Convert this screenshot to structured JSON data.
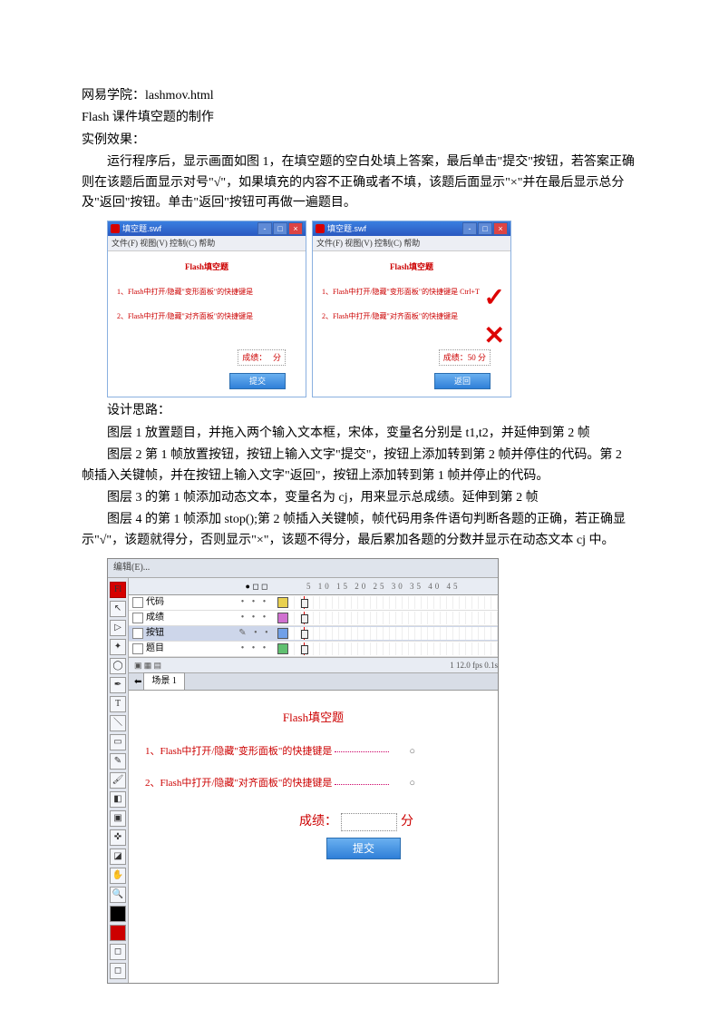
{
  "header": {
    "line1": "网易学院：lashmov.html",
    "line2": "Flash 课件填空题的制作",
    "line3": "实例效果："
  },
  "intro": "运行程序后，显示画面如图 1，在填空题的空白处填上答案，最后单击\"提交\"按钮，若答案正确则在该题后面显示对号\"√\"，如果填充的内容不正确或者不填，该题后面显示\"×\"并在最后显示总分及\"返回\"按钮。单击\"返回\"按钮可再做一遍题目。",
  "swf": {
    "winTitle": "填空题.swf",
    "menu": "文件(F) 视图(V) 控制(C) 帮助",
    "heading": "Flash填空题",
    "q1": "1、Flash中打开/隐藏\"变形面板\"的快捷键是",
    "q2": "2、Flash中打开/隐藏\"对齐面板\"的快捷键是",
    "q1r": "1、Flash中打开/隐藏\"变形面板\"的快捷键是  Ctrl+T",
    "q2r": "2、Flash中打开/隐藏\"对齐面板\"的快捷键是",
    "scoreLabel": "成绩：",
    "scoreUnit": "分",
    "scoreR": "成绩：50  分",
    "submit": "提交",
    "returnBtn": "返回"
  },
  "design": {
    "title": "设计思路：",
    "p1": "图层 1 放置题目，并拖入两个输入文本框，宋体，变量名分别是 t1,t2，并延伸到第 2 帧",
    "p2": "图层 2 第 1 帧放置按钮，按钮上输入文字\"提交\"，按钮上添加转到第 2 帧并停住的代码。第 2 帧插入关键帧，并在按钮上输入文字\"返回\"，按钮上添加转到第 1 帧并停止的代码。",
    "p3": "图层 3 的第 1 帧添加动态文本，变量名为 cj，用来显示总成绩。延伸到第 2 帧",
    "p4": "图层 4 的第 1 帧添加 stop();第 2 帧插入关键帧，帧代码用条件语句判断各题的正确，若正确显示\"√\"，该题就得分，否则显示\"×\"，该题不得分，最后累加各题的分数并显示在动态文本 cj 中。"
  },
  "editor": {
    "menu": "编辑(E)...",
    "timelineNums": "5   10   15   20   25   30   35   40   45",
    "layers": [
      {
        "name": "代码",
        "color": "#e8d050"
      },
      {
        "name": "成绩",
        "color": "#d070d0"
      },
      {
        "name": "按钮",
        "color": "#70a0e8",
        "sel": true
      },
      {
        "name": "题目",
        "color": "#60c070"
      }
    ],
    "status": "1   12.0 fps   0.1s",
    "tab": "场景 1",
    "stage": {
      "heading": "Flash填空题",
      "q1": "1、Flash中打开/隐藏\"变形面板\"的快捷键是",
      "q2": "2、Flash中打开/隐藏\"对齐面板\"的快捷键是",
      "scoreLabel": "成绩：",
      "fen": "分",
      "submit": "提交"
    }
  }
}
